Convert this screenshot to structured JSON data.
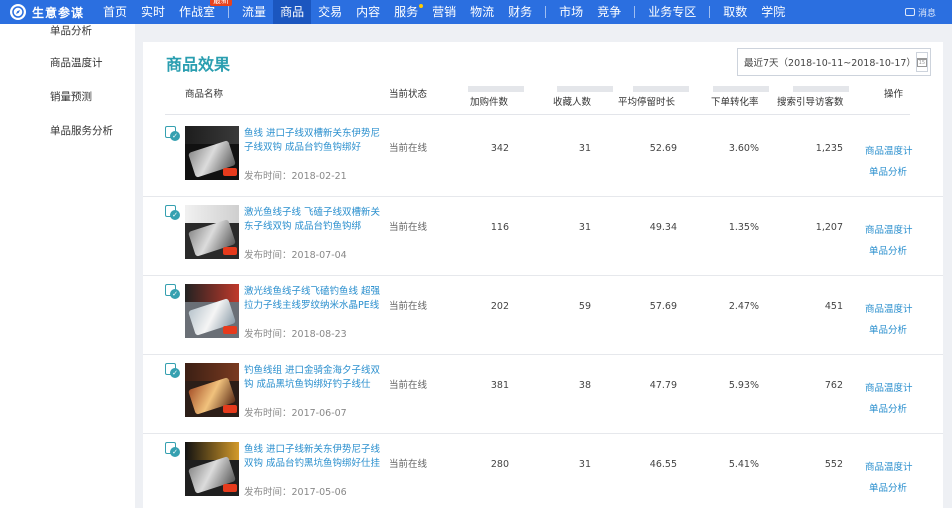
{
  "topbar": {
    "brand": "生意参谋",
    "nav": [
      {
        "label": "首页"
      },
      {
        "label": "实时"
      },
      {
        "label": "作战室",
        "badge": "最新"
      },
      {
        "label": "流量"
      },
      {
        "label": "商品",
        "active": true
      },
      {
        "label": "交易"
      },
      {
        "label": "内容"
      },
      {
        "label": "服务",
        "dot": true
      },
      {
        "label": "营销"
      },
      {
        "label": "物流"
      },
      {
        "label": "财务"
      },
      {
        "label": "市场"
      },
      {
        "label": "竞争"
      },
      {
        "label": "业务专区"
      },
      {
        "label": "取数"
      },
      {
        "label": "学院"
      }
    ],
    "message_label": "消息",
    "accent": "#2b6fe0",
    "active_bg": "#1b56bf"
  },
  "sidebar": {
    "items": [
      {
        "label": "单品分析"
      },
      {
        "label": "商品温度计"
      },
      {
        "label": "销量预测"
      },
      {
        "label": "单品服务分析"
      }
    ]
  },
  "panel": {
    "title": "商品效果",
    "title_color": "#2a9eb0",
    "date_range": "最近7天（2018-10-11~2018-10-17）",
    "calendar_icon": "calendar-icon"
  },
  "table": {
    "columns": {
      "name": "商品名称",
      "status": "当前状态",
      "cart": "加购件数",
      "fav": "收藏人数",
      "stay": "平均停留时长",
      "conv": "下单转化率",
      "search": "搜索引导访客数",
      "ops": "操作"
    },
    "rows": [
      {
        "title": "鱼线 进口子线双槽新关东伊势尼子线双钩 成品台钓鱼钩绑好",
        "date": "发布时间：2018-02-21",
        "status": "当前在线",
        "cart": "342",
        "fav": "31",
        "stay": "52.69",
        "conv": "3.60%",
        "search": "1,235",
        "act1": "商品温度计",
        "act2": "单品分析"
      },
      {
        "title": "激光鱼线子线 飞磕子线双槽新关东子线双钩 成品台钓鱼钩绑",
        "date": "发布时间：2018-07-04",
        "status": "当前在线",
        "cart": "116",
        "fav": "31",
        "stay": "49.34",
        "conv": "1.35%",
        "search": "1,207",
        "act1": "商品温度计",
        "act2": "单品分析"
      },
      {
        "title": "激光线鱼线子线飞磕钓鱼线 超强拉力子线主线罗纹纳米水晶PE线",
        "date": "发布时间：2018-08-23",
        "status": "当前在线",
        "cart": "202",
        "fav": "59",
        "stay": "57.69",
        "conv": "2.47%",
        "search": "451",
        "act1": "商品温度计",
        "act2": "单品分析"
      },
      {
        "title": "钓鱼线组 进口金骑金海夕子线双钩 成品黑坑鱼钩绑好钓子线仕",
        "date": "发布时间：2017-06-07",
        "status": "当前在线",
        "cart": "381",
        "fav": "38",
        "stay": "47.79",
        "conv": "5.93%",
        "search": "762",
        "act1": "商品温度计",
        "act2": "单品分析"
      },
      {
        "title": "鱼线 进口子线新关东伊势尼子线双钩 成品台钓黑坑鱼钩绑好仕挂",
        "date": "发布时间：2017-05-06",
        "status": "当前在线",
        "cart": "280",
        "fav": "31",
        "stay": "46.55",
        "conv": "5.41%",
        "search": "552",
        "act1": "商品温度计",
        "act2": "单品分析"
      }
    ]
  }
}
